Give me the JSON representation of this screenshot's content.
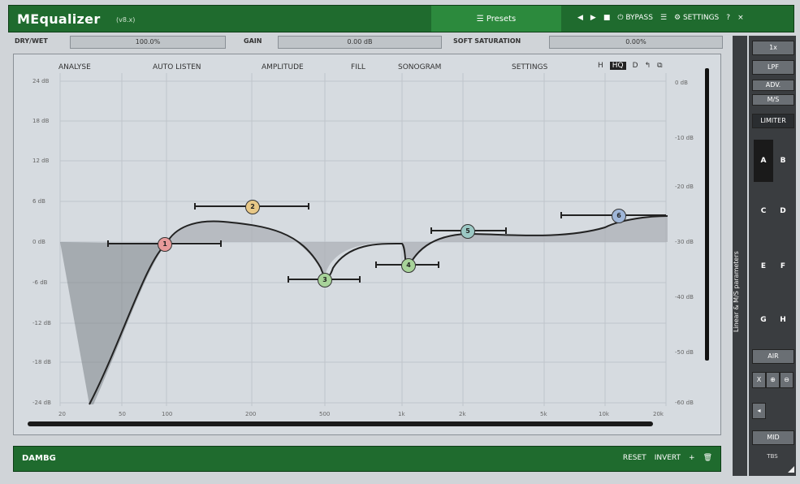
{
  "app": {
    "title": "MEqualizer",
    "version": "(v8.x)"
  },
  "topbar": {
    "presets_label": "☰ Presets",
    "prev_label": "◀",
    "next_label": "▶",
    "save_label": "■",
    "bypass_label": "⏻ BYPASS",
    "menu_label": "☰",
    "settings_label": "⚙ SETTINGS",
    "help_label": "?",
    "close_label": "×"
  },
  "params": {
    "drywet_label": "DRY/WET",
    "drywet_value": "100.0%",
    "gain_label": "GAIN",
    "gain_value": "0.00 dB",
    "softsat_label": "SOFT SATURATION",
    "softsat_value": "0.00%"
  },
  "tabs": [
    "ANALYSE",
    "AUTO LISTEN",
    "AMPLITUDE",
    "FILL",
    "SONOGRAM",
    "SETTINGS"
  ],
  "graph_icons": {
    "a": "H",
    "b": "HQ",
    "c": "D",
    "d": "↰",
    "e": "⧉"
  },
  "y_left": [
    "24 dB",
    "18 dB",
    "12 dB",
    "6 dB",
    "0 dB",
    "-6 dB",
    "-12 dB",
    "-18 dB",
    "-24 dB"
  ],
  "y_right": [
    "0 dB",
    "-10 dB",
    "-20 dB",
    "-30 dB",
    "-40 dB",
    "-50 dB",
    "-60 dB"
  ],
  "x_ticks": [
    "20",
    "50",
    "100",
    "200",
    "500",
    "1k",
    "2k",
    "5k",
    "10k",
    "20k"
  ],
  "bands": [
    {
      "label": "1",
      "color": "#e79a9a"
    },
    {
      "label": "2",
      "color": "#e8c887"
    },
    {
      "label": "3",
      "color": "#a8d39a"
    },
    {
      "label": "4",
      "color": "#a8d39a"
    },
    {
      "label": "5",
      "color": "#9bc8c4"
    },
    {
      "label": "6",
      "color": "#9fb6d8"
    }
  ],
  "footer": {
    "name": "DAMBG",
    "reset_label": "RESET",
    "invert_label": "INVERT",
    "plus_label": "+",
    "trash_label": "🗑"
  },
  "side": {
    "vertical_label": "Linear & M/S parameters"
  },
  "right_panel": {
    "btn1": "1x",
    "btn2": "LPF",
    "btn3": "ADV.",
    "btn4": "M/S",
    "limiter": "LIMITER",
    "cells": [
      "A",
      "B",
      "C",
      "D",
      "E",
      "F",
      "G",
      "H"
    ],
    "air": "AIR",
    "small": [
      "X",
      "⊕",
      "⊖"
    ],
    "mid": "MID",
    "foot": "TBS"
  }
}
